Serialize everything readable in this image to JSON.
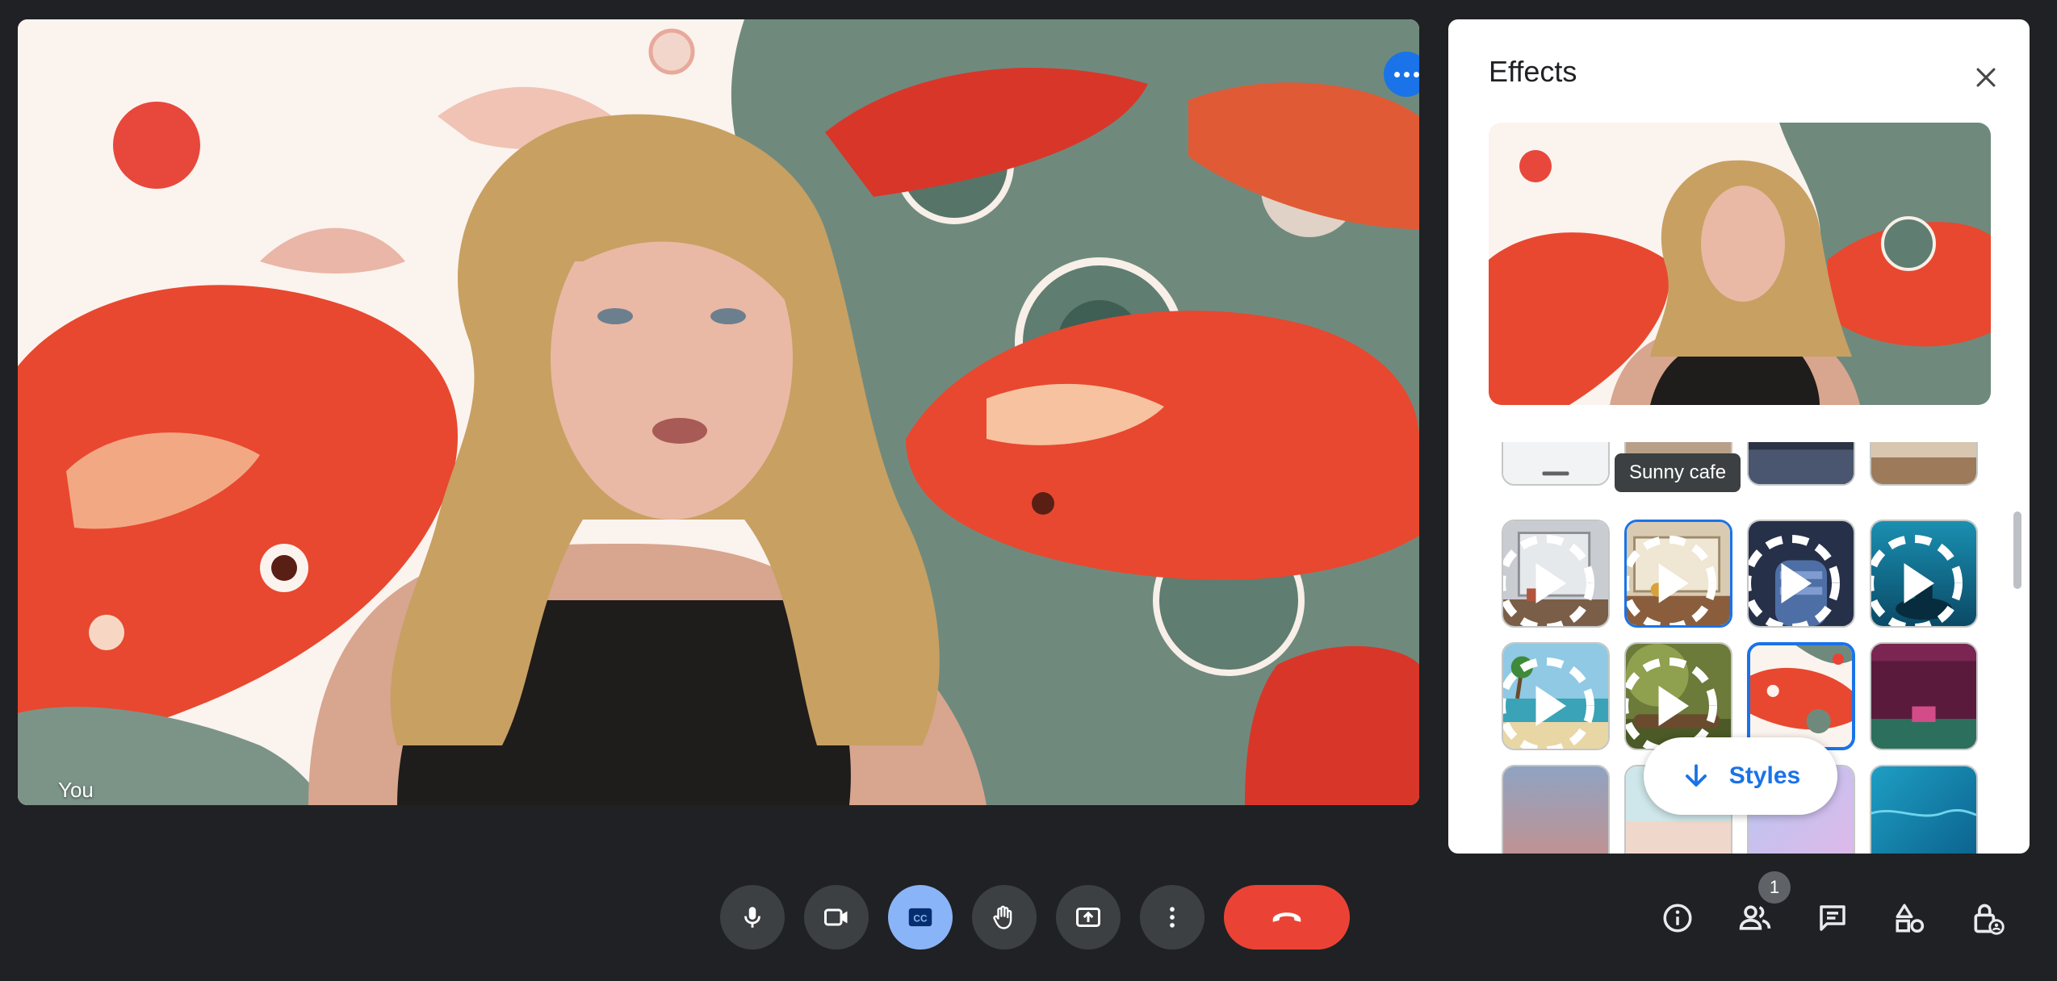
{
  "video": {
    "self_label": "You",
    "menu_icon": "more-horizontal-icon",
    "accent": "#1a73e8"
  },
  "effects_panel": {
    "title": "Effects",
    "close_icon": "close-icon",
    "tooltip": "Sunny cafe",
    "styles_button_label": "Styles",
    "styles_button_icon": "arrow-down-icon",
    "selected_background": "koi-fish-illustration",
    "thumbnails": [
      {
        "name": "blank-partial",
        "animated": false
      },
      {
        "name": "sunny-cafe-partial",
        "animated": false
      },
      {
        "name": "night-room-partial",
        "animated": false
      },
      {
        "name": "library-partial",
        "animated": false
      },
      {
        "name": "winter-window",
        "animated": true
      },
      {
        "name": "sunny-cafe",
        "animated": true
      },
      {
        "name": "spaceship-seat",
        "animated": true
      },
      {
        "name": "underwater-cave",
        "animated": true
      },
      {
        "name": "tropical-beach",
        "animated": true
      },
      {
        "name": "forest-log",
        "animated": true
      },
      {
        "name": "koi-fish",
        "animated": false
      },
      {
        "name": "theater-stage",
        "animated": false
      },
      {
        "name": "dusk-gradient",
        "animated": false
      },
      {
        "name": "pastel-beach",
        "animated": false
      },
      {
        "name": "lavender-gradient",
        "animated": false
      },
      {
        "name": "pool-water",
        "animated": false
      }
    ]
  },
  "toolbar": {
    "buttons": [
      {
        "name": "microphone-button",
        "icon": "microphone-icon"
      },
      {
        "name": "camera-button",
        "icon": "video-camera-icon"
      },
      {
        "name": "captions-button",
        "icon": "closed-captions-icon",
        "active": true
      },
      {
        "name": "raise-hand-button",
        "icon": "hand-icon"
      },
      {
        "name": "present-button",
        "icon": "present-screen-icon"
      },
      {
        "name": "more-options-button",
        "icon": "more-vertical-icon"
      },
      {
        "name": "leave-call-button",
        "icon": "phone-hangup-icon"
      }
    ],
    "side": [
      {
        "name": "meeting-info-button",
        "icon": "info-icon"
      },
      {
        "name": "people-button",
        "icon": "people-icon",
        "badge": "1"
      },
      {
        "name": "chat-button",
        "icon": "chat-icon"
      },
      {
        "name": "activities-button",
        "icon": "shapes-icon"
      },
      {
        "name": "host-controls-button",
        "icon": "lock-person-icon"
      }
    ],
    "end_call_color": "#ea4335",
    "active_color": "#8ab4f8"
  }
}
